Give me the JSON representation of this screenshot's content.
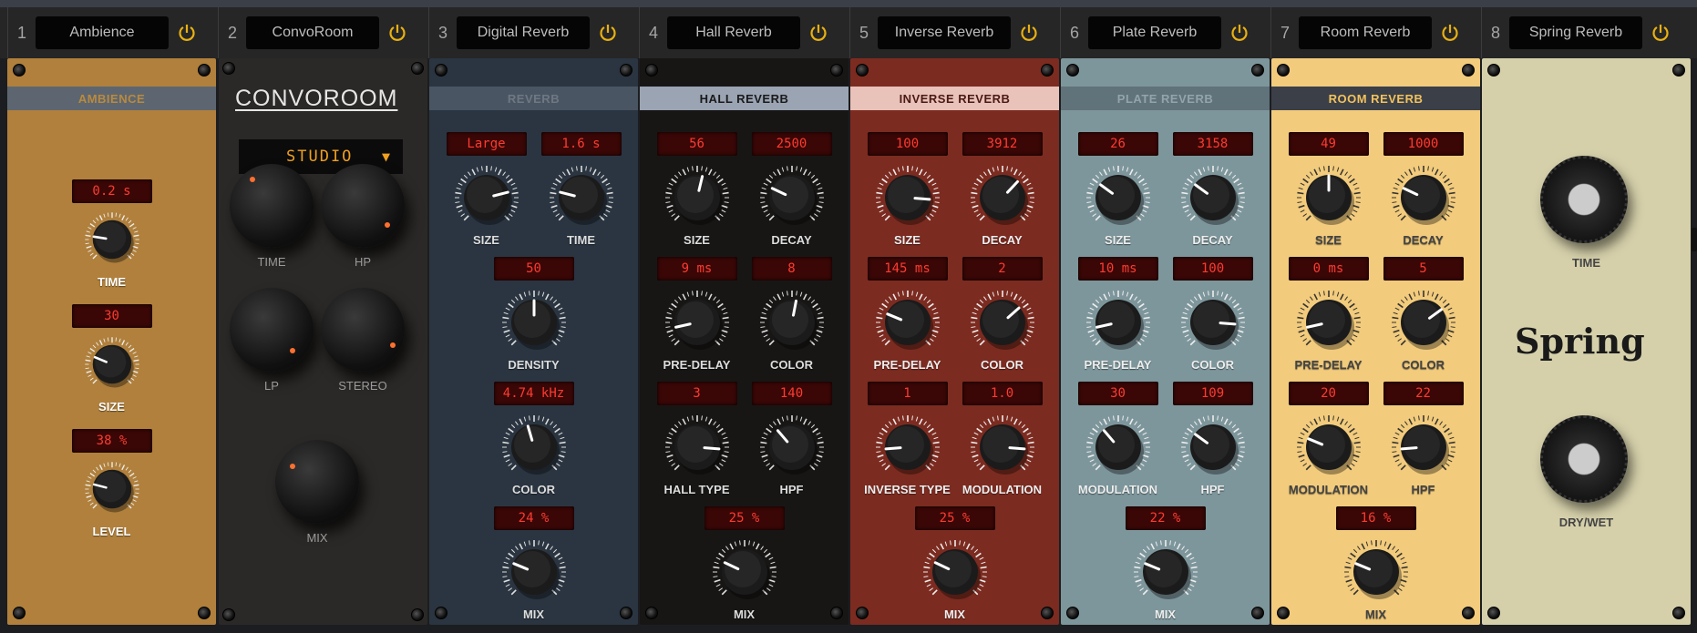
{
  "slots": [
    {
      "num": "1",
      "name": "Ambience"
    },
    {
      "num": "2",
      "name": "ConvoRoom"
    },
    {
      "num": "3",
      "name": "Digital Reverb"
    },
    {
      "num": "4",
      "name": "Hall Reverb"
    },
    {
      "num": "5",
      "name": "Inverse Reverb"
    },
    {
      "num": "6",
      "name": "Plate Reverb"
    },
    {
      "num": "7",
      "name": "Room Reverb"
    },
    {
      "num": "8",
      "name": "Spring Reverb"
    }
  ],
  "colors": {
    "power": "#e8b012",
    "display_text": "#ff3a30"
  },
  "modules": {
    "ambience": {
      "title": "AMBIENCE",
      "rows": [
        [
          {
            "label": "TIME",
            "value": "0.2 s",
            "pos": 0.2
          }
        ],
        [
          {
            "label": "SIZE",
            "value": "30",
            "pos": 0.25
          }
        ],
        [
          {
            "label": "LEVEL",
            "value": "38 %",
            "pos": 0.22
          }
        ]
      ]
    },
    "convoroom": {
      "logo": "CONVOROOM",
      "preset": "STUDIO",
      "knobs": [
        {
          "label": "TIME",
          "pos": 0.1
        },
        {
          "label": "HP",
          "pos": 0.75
        },
        {
          "label": "LP",
          "pos": 0.7
        },
        {
          "label": "STEREO",
          "pos": 0.75
        },
        {
          "label": "MIX",
          "pos": 0.15
        }
      ]
    },
    "digital": {
      "title": "REVERB",
      "rows": [
        [
          {
            "label": "SIZE",
            "value": "Large",
            "pos": 0.78
          },
          {
            "label": "TIME",
            "value": "1.6 s",
            "pos": 0.22
          }
        ],
        [
          {
            "label": "DENSITY",
            "value": "50",
            "pos": 0.5
          }
        ],
        [
          {
            "label": "COLOR",
            "value": "4.74 kHz",
            "pos": 0.44
          }
        ],
        [
          {
            "label": "MIX",
            "value": "24 %",
            "pos": 0.25
          }
        ]
      ]
    },
    "hall": {
      "title": "HALL REVERB",
      "rows": [
        [
          {
            "label": "SIZE",
            "value": "56",
            "pos": 0.55
          },
          {
            "label": "DECAY",
            "value": "2500",
            "pos": 0.26
          }
        ],
        [
          {
            "label": "PRE-DELAY",
            "value": "9 ms",
            "pos": 0.12
          },
          {
            "label": "COLOR",
            "value": "8",
            "pos": 0.54
          }
        ],
        [
          {
            "label": "HALL TYPE",
            "value": "3",
            "pos": 0.85
          },
          {
            "label": "HPF",
            "value": "140",
            "pos": 0.35
          }
        ],
        [
          {
            "label": "MIX",
            "value": "25 %",
            "pos": 0.26
          }
        ]
      ]
    },
    "inverse": {
      "title": "INVERSE REVERB",
      "rows": [
        [
          {
            "label": "SIZE",
            "value": "100",
            "pos": 0.85
          },
          {
            "label": "DECAY",
            "value": "3912",
            "pos": 0.66
          }
        ],
        [
          {
            "label": "PRE-DELAY",
            "value": "145 ms",
            "pos": 0.25
          },
          {
            "label": "COLOR",
            "value": "2",
            "pos": 0.68
          }
        ],
        [
          {
            "label": "INVERSE TYPE",
            "value": "1",
            "pos": 0.15
          },
          {
            "label": "MODULATION",
            "value": "1.0",
            "pos": 0.85
          }
        ],
        [
          {
            "label": "MIX",
            "value": "25 %",
            "pos": 0.26
          }
        ]
      ]
    },
    "plate": {
      "title": "PLATE REVERB",
      "rows": [
        [
          {
            "label": "SIZE",
            "value": "26",
            "pos": 0.3
          },
          {
            "label": "DECAY",
            "value": "3158",
            "pos": 0.3
          }
        ],
        [
          {
            "label": "PRE-DELAY",
            "value": "10 ms",
            "pos": 0.12
          },
          {
            "label": "COLOR",
            "value": "100",
            "pos": 0.85
          }
        ],
        [
          {
            "label": "MODULATION",
            "value": "30",
            "pos": 0.35
          },
          {
            "label": "HPF",
            "value": "109",
            "pos": 0.3
          }
        ],
        [
          {
            "label": "MIX",
            "value": "22 %",
            "pos": 0.25
          }
        ]
      ]
    },
    "room": {
      "title": "ROOM REVERB",
      "rows": [
        [
          {
            "label": "SIZE",
            "value": "49",
            "pos": 0.5
          },
          {
            "label": "DECAY",
            "value": "1000",
            "pos": 0.26
          }
        ],
        [
          {
            "label": "PRE-DELAY",
            "value": "0 ms",
            "pos": 0.12
          },
          {
            "label": "COLOR",
            "value": "5",
            "pos": 0.7
          }
        ],
        [
          {
            "label": "MODULATION",
            "value": "20",
            "pos": 0.25
          },
          {
            "label": "HPF",
            "value": "22",
            "pos": 0.15
          }
        ],
        [
          {
            "label": "MIX",
            "value": "16 %",
            "pos": 0.25
          }
        ]
      ]
    },
    "spring": {
      "logo": "Spring",
      "knobs": [
        {
          "label": "TIME",
          "pos": 0.7
        },
        {
          "label": "DRY/WET",
          "pos": 0.85
        }
      ]
    }
  }
}
